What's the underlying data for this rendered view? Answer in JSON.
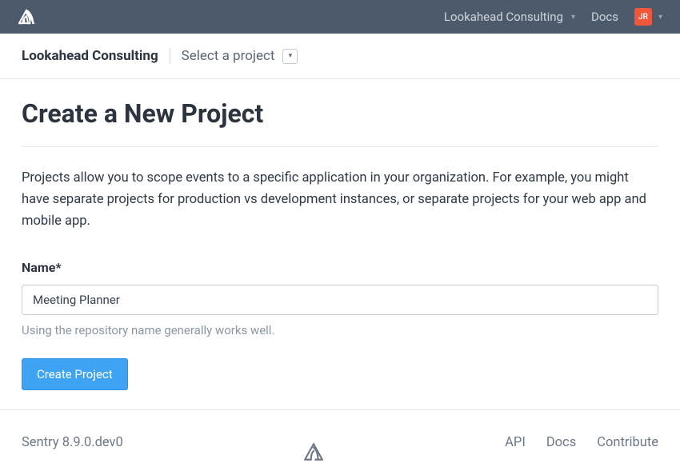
{
  "navbar": {
    "org_label": "Lookahead Consulting",
    "docs_label": "Docs",
    "avatar_initials": "JR"
  },
  "subheader": {
    "org_name": "Lookahead Consulting",
    "project_select_label": "Select a project"
  },
  "page": {
    "title": "Create a New Project",
    "description": "Projects allow you to scope events to a specific application in your organization. For example, you might have separate projects for production vs development instances, or separate projects for your web app and mobile app."
  },
  "form": {
    "name_label": "Name*",
    "name_value": "Meeting Planner",
    "name_help": "Using the repository name generally works well.",
    "submit_label": "Create Project"
  },
  "footer": {
    "version": "Sentry 8.9.0.dev0",
    "links": {
      "api": "API",
      "docs": "Docs",
      "contribute": "Contribute"
    }
  }
}
